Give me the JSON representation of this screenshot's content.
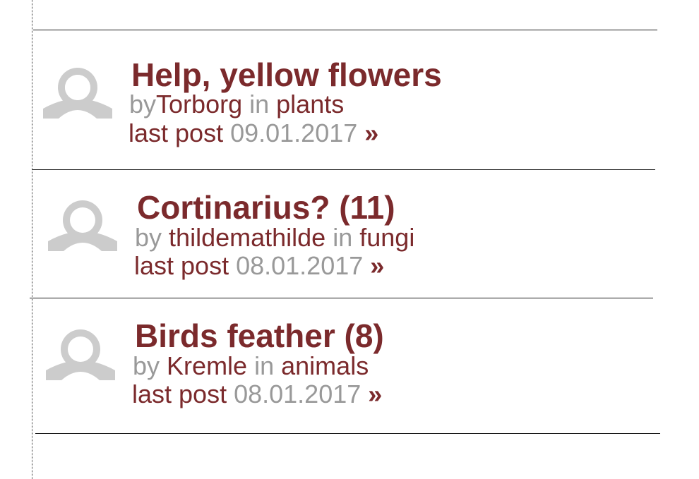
{
  "threads": [
    {
      "title": "Help, yellow flowers",
      "by_prefix": "by",
      "author": "Torborg",
      "in_word": "in",
      "category": "plants",
      "last_post_label": "last post",
      "last_post_date": "09.01.2017",
      "arrow": "»",
      "avatar_icon": "default-user-avatar"
    },
    {
      "title": "Cortinarius? (11)",
      "by_prefix": "by",
      "author": "thildemathilde",
      "in_word": "in",
      "category": "fungi",
      "last_post_label": "last post",
      "last_post_date": "08.01.2017",
      "arrow": "»",
      "avatar_icon": "default-user-avatar"
    },
    {
      "title": "Birds feather (8)",
      "by_prefix": "by",
      "author": "Kremle",
      "in_word": "in",
      "category": "animals",
      "last_post_label": "last post",
      "last_post_date": "08.01.2017",
      "arrow": "»",
      "avatar_icon": "default-user-avatar"
    }
  ],
  "colors": {
    "link": "#7b2a2c",
    "muted": "#999999",
    "avatar": "#cccccc"
  }
}
